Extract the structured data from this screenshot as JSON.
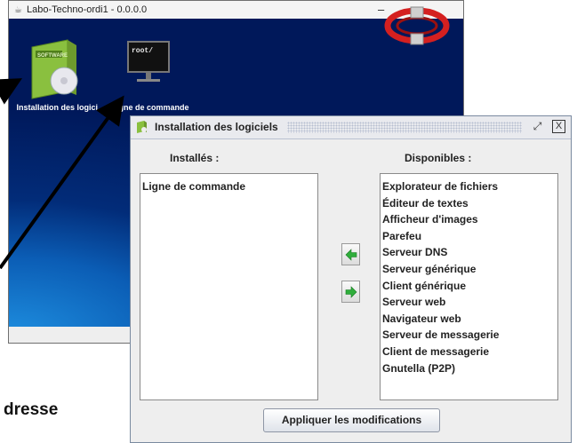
{
  "desktop_window": {
    "title": "Labo-Techno-ordi1 - 0.0.0.0",
    "minimize_label": "–"
  },
  "desktop_icons": [
    {
      "name": "software",
      "icon_badge": "SOFTWARE",
      "label": "Installation des logici..."
    },
    {
      "name": "terminal",
      "icon_badge": "root/",
      "label": "Ligne de commande"
    }
  ],
  "partial_text": "dresse",
  "dialog": {
    "title": "Installation des logiciels",
    "maximize_label": "⤢",
    "close_label": "X",
    "installed_header": "Installés :",
    "available_header": "Disponibles :",
    "installed": [
      "Ligne de commande"
    ],
    "available": [
      "Explorateur de fichiers",
      "Éditeur de textes",
      "Afficheur d'images",
      "Parefeu",
      "Serveur DNS",
      "Serveur générique",
      "Client générique",
      "Serveur web",
      "Navigateur web",
      "Serveur de messagerie",
      "Client de messagerie",
      "Gnutella (P2P)"
    ],
    "apply_label": "Appliquer les modifications"
  },
  "colors": {
    "desktop_blue": "#0b5db5",
    "logo_red": "#d42020",
    "arrow_green": "#2fae3b"
  }
}
